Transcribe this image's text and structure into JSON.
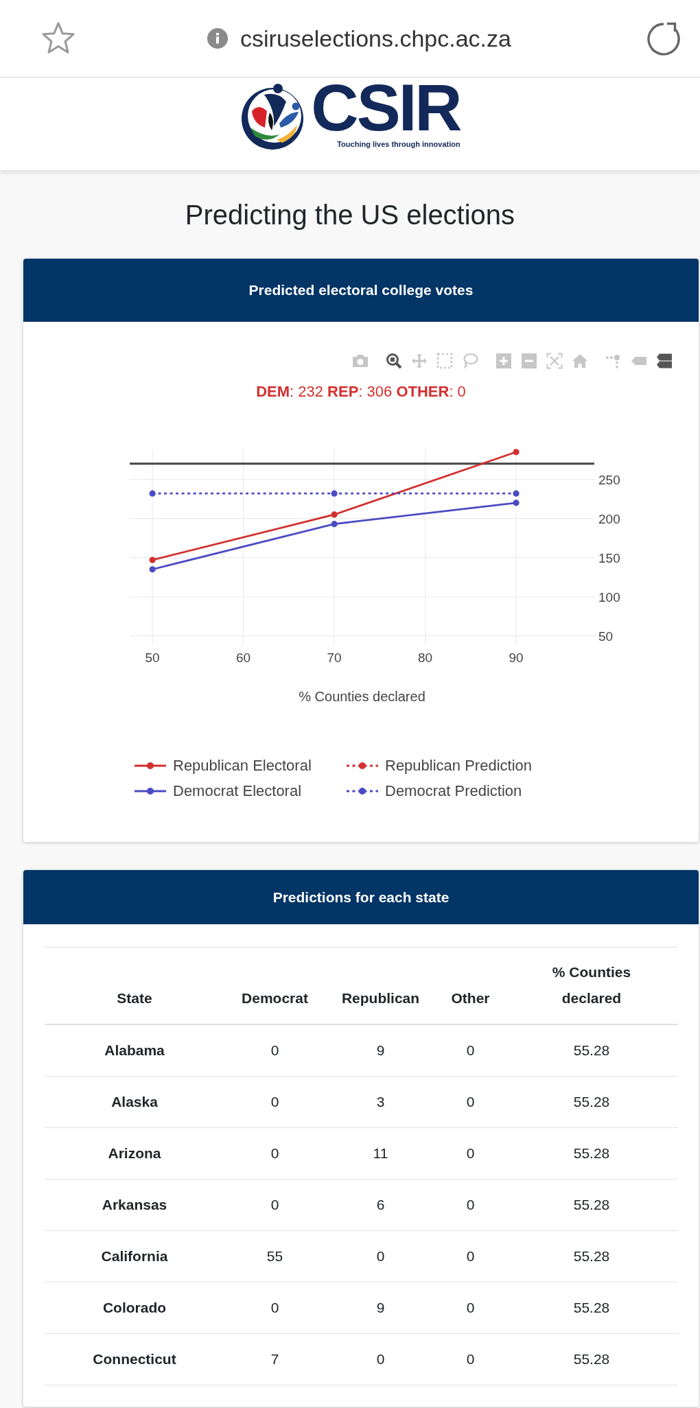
{
  "browser_bar": {
    "url": "csiruselections.chpc.ac.za"
  },
  "site_header": {
    "logo_text": "CSIR",
    "tagline": "Touching lives through innovation"
  },
  "page_title": "Predicting the US elections",
  "votes_card": {
    "title": "Predicted electoral college votes",
    "modebar_groups": [
      {
        "buttons": [
          {
            "kind": "camera",
            "selected": false
          }
        ]
      },
      {
        "buttons": [
          {
            "kind": "zoom",
            "selected": true
          },
          {
            "kind": "pan",
            "selected": false
          },
          {
            "kind": "box_select",
            "selected": false
          },
          {
            "kind": "lasso",
            "selected": false
          }
        ]
      },
      {
        "buttons": [
          {
            "kind": "zoom_in",
            "selected": false
          },
          {
            "kind": "zoom_out",
            "selected": false
          },
          {
            "kind": "autoscale",
            "selected": false
          },
          {
            "kind": "reset",
            "selected": false
          }
        ]
      },
      {
        "buttons": [
          {
            "kind": "spikelines",
            "selected": false
          },
          {
            "kind": "closest",
            "selected": false
          },
          {
            "kind": "compare",
            "selected": true
          }
        ]
      }
    ],
    "summary": "**DEM**: 232 **REP**: 306 **OTHER**: 0",
    "chart_data": {
      "type": "line",
      "xlabel": "% Counties declared",
      "x": [
        50,
        70,
        90
      ],
      "grid": true,
      "series": [
        {
          "name": "Republican Electoral",
          "color": "#d32f2f",
          "line_style": "solid",
          "marker": "circle",
          "values": [
            147,
            205,
            285
          ]
        },
        {
          "name": "Republican Prediction",
          "color": "#d32f2f",
          "line_style": "dotted",
          "marker": "circle",
          "values": [
            null,
            null,
            null
          ]
        },
        {
          "name": "Democrat Electoral",
          "color": "#4b4bc4",
          "line_style": "solid",
          "marker": "circle",
          "values": [
            135,
            193,
            220
          ]
        },
        {
          "name": "Democrat Prediction",
          "color": "#4b4bc4",
          "line_style": "dotted",
          "marker": "circle",
          "values": [
            232,
            232,
            232
          ]
        }
      ],
      "xlim": [
        47.5,
        98.6
      ],
      "ylim": [
        38.3,
        288.3
      ],
      "xticks": [
        50,
        60,
        70,
        80,
        90
      ],
      "yticks": [
        50,
        100,
        150,
        200,
        250
      ],
      "ref_lines": [
        {
          "axis": "y",
          "value": 270,
          "color": "#444444"
        }
      ]
    }
  },
  "states_card": {
    "title": "Predictions for each state",
    "table": {
      "columns": [
        "State",
        "Democrat",
        "Republican",
        "Other",
        "% Counties declared"
      ],
      "rows": [
        [
          "Alabama",
          "0",
          "9",
          "0",
          "55.28"
        ],
        [
          "Alaska",
          "0",
          "3",
          "0",
          "55.28"
        ],
        [
          "Arizona",
          "0",
          "11",
          "0",
          "55.28"
        ],
        [
          "Arkansas",
          "0",
          "6",
          "0",
          "55.28"
        ],
        [
          "California",
          "55",
          "0",
          "0",
          "55.28"
        ],
        [
          "Colorado",
          "0",
          "9",
          "0",
          "55.28"
        ],
        [
          "Connecticut",
          "7",
          "0",
          "0",
          "55.28"
        ]
      ]
    }
  }
}
